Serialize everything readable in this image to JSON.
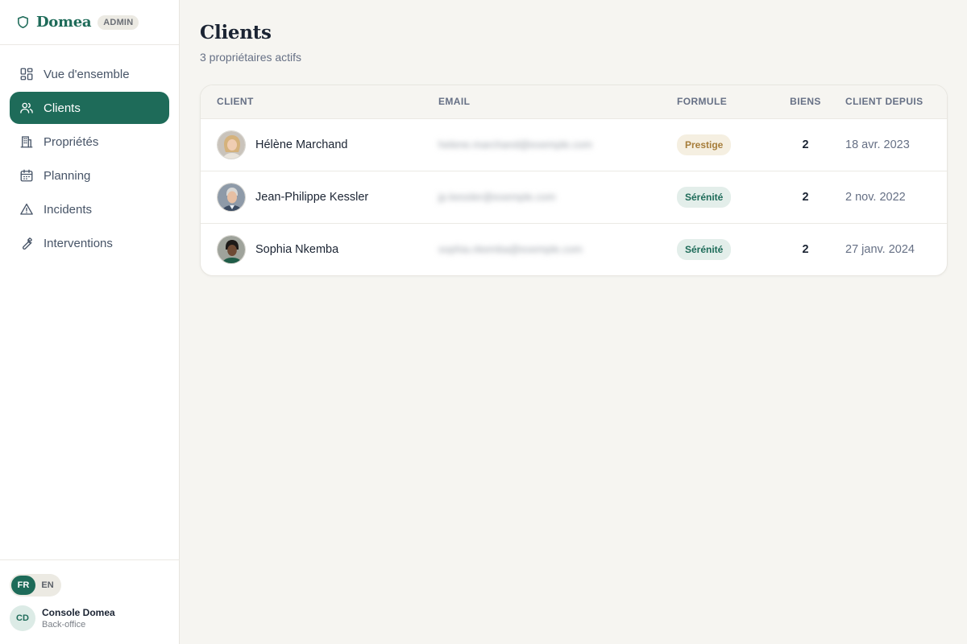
{
  "brand": {
    "name": "Domea",
    "badge": "ADMIN"
  },
  "sidebar": {
    "items": [
      {
        "label": "Vue d'ensemble",
        "icon": "dashboard-grid-icon",
        "active": false
      },
      {
        "label": "Clients",
        "icon": "users-icon",
        "active": true
      },
      {
        "label": "Propriétés",
        "icon": "building-icon",
        "active": false
      },
      {
        "label": "Planning",
        "icon": "calendar-icon",
        "active": false
      },
      {
        "label": "Incidents",
        "icon": "warning-triangle-icon",
        "active": false
      },
      {
        "label": "Interventions",
        "icon": "wrench-icon",
        "active": false
      }
    ]
  },
  "footer": {
    "languages": [
      {
        "code": "FR",
        "active": true
      },
      {
        "code": "EN",
        "active": false
      }
    ],
    "user": {
      "initials": "CD",
      "name": "Console Domea",
      "role": "Back-office"
    }
  },
  "page": {
    "title": "Clients",
    "subtitle": "3 propriétaires actifs"
  },
  "table": {
    "columns": [
      "CLIENT",
      "EMAIL",
      "FORMULE",
      "BIENS",
      "CLIENT DEPUIS"
    ],
    "rows": [
      {
        "name": "Hélène Marchand",
        "email": "helene.marchand@exemple.com",
        "formule": "Prestige",
        "formule_style": "prestige",
        "biens": "2",
        "depuis": "18 avr. 2023"
      },
      {
        "name": "Jean-Philippe Kessler",
        "email": "jp.kessler@exemple.com",
        "formule": "Sérénité",
        "formule_style": "serenite",
        "biens": "2",
        "depuis": "2 nov. 2022"
      },
      {
        "name": "Sophia Nkemba",
        "email": "sophia.nkemba@exemple.com",
        "formule": "Sérénité",
        "formule_style": "serenite",
        "biens": "2",
        "depuis": "27 janv. 2024"
      }
    ]
  },
  "colors": {
    "brand_green": "#1e6b59",
    "background": "#f6f5f1",
    "prestige_bg": "#f5efe1",
    "prestige_text": "#a67d3a",
    "serenite_bg": "#e3eeea",
    "serenite_text": "#1e6b59"
  }
}
